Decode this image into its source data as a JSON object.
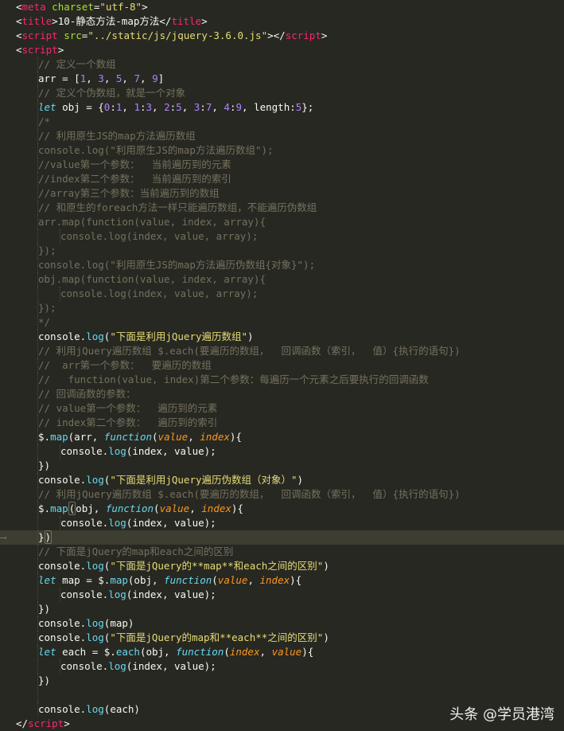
{
  "editor": {
    "lines": [
      {
        "indent": 0,
        "tokens": [
          {
            "t": "<",
            "c": "text"
          },
          {
            "t": "meta",
            "c": "tag"
          },
          {
            "t": " ",
            "c": "text"
          },
          {
            "t": "charset",
            "c": "attr"
          },
          {
            "t": "=",
            "c": "text"
          },
          {
            "t": "\"utf-8\"",
            "c": "str"
          },
          {
            "t": ">",
            "c": "text"
          }
        ]
      },
      {
        "indent": 0,
        "tokens": [
          {
            "t": "<",
            "c": "text"
          },
          {
            "t": "title",
            "c": "tag"
          },
          {
            "t": ">10-静态方法-map方法</",
            "c": "text"
          },
          {
            "t": "title",
            "c": "tag"
          },
          {
            "t": ">",
            "c": "text"
          }
        ]
      },
      {
        "indent": 0,
        "tokens": [
          {
            "t": "<",
            "c": "text"
          },
          {
            "t": "script",
            "c": "tag"
          },
          {
            "t": " ",
            "c": "text"
          },
          {
            "t": "src",
            "c": "attr"
          },
          {
            "t": "=",
            "c": "text"
          },
          {
            "t": "\"../static/js/jquery-3.6.0.js\"",
            "c": "str"
          },
          {
            "t": "></",
            "c": "text"
          },
          {
            "t": "script",
            "c": "tag"
          },
          {
            "t": ">",
            "c": "text"
          }
        ]
      },
      {
        "indent": 0,
        "tokens": [
          {
            "t": "<",
            "c": "text"
          },
          {
            "t": "script",
            "c": "tag"
          },
          {
            "t": ">",
            "c": "text"
          }
        ]
      },
      {
        "indent": 1,
        "tokens": [
          {
            "t": "// 定义一个数组",
            "c": "cmt"
          }
        ]
      },
      {
        "indent": 1,
        "tokens": [
          {
            "t": "arr = [",
            "c": "text"
          },
          {
            "t": "1",
            "c": "num"
          },
          {
            "t": ", ",
            "c": "text"
          },
          {
            "t": "3",
            "c": "num"
          },
          {
            "t": ", ",
            "c": "text"
          },
          {
            "t": "5",
            "c": "num"
          },
          {
            "t": ", ",
            "c": "text"
          },
          {
            "t": "7",
            "c": "num"
          },
          {
            "t": ", ",
            "c": "text"
          },
          {
            "t": "9",
            "c": "num"
          },
          {
            "t": "]",
            "c": "text"
          }
        ]
      },
      {
        "indent": 1,
        "tokens": [
          {
            "t": "// 定义个伪数组，就是一个对象",
            "c": "cmt"
          }
        ]
      },
      {
        "indent": 1,
        "tokens": [
          {
            "t": "let",
            "c": "kw"
          },
          {
            "t": " obj = {",
            "c": "text"
          },
          {
            "t": "0",
            "c": "num"
          },
          {
            "t": ":",
            "c": "text"
          },
          {
            "t": "1",
            "c": "num"
          },
          {
            "t": ", ",
            "c": "text"
          },
          {
            "t": "1",
            "c": "num"
          },
          {
            "t": ":",
            "c": "text"
          },
          {
            "t": "3",
            "c": "num"
          },
          {
            "t": ", ",
            "c": "text"
          },
          {
            "t": "2",
            "c": "num"
          },
          {
            "t": ":",
            "c": "text"
          },
          {
            "t": "5",
            "c": "num"
          },
          {
            "t": ", ",
            "c": "text"
          },
          {
            "t": "3",
            "c": "num"
          },
          {
            "t": ":",
            "c": "text"
          },
          {
            "t": "7",
            "c": "num"
          },
          {
            "t": ", ",
            "c": "text"
          },
          {
            "t": "4",
            "c": "num"
          },
          {
            "t": ":",
            "c": "text"
          },
          {
            "t": "9",
            "c": "num"
          },
          {
            "t": ", length:",
            "c": "text"
          },
          {
            "t": "5",
            "c": "num"
          },
          {
            "t": "};",
            "c": "text"
          }
        ]
      },
      {
        "indent": 1,
        "tokens": [
          {
            "t": "/*",
            "c": "cmt"
          }
        ]
      },
      {
        "indent": 1,
        "tokens": [
          {
            "t": "// 利用原生JS的map方法遍历数组",
            "c": "cmt"
          }
        ]
      },
      {
        "indent": 1,
        "tokens": [
          {
            "t": "console.log(\"利用原生JS的map方法遍历数组\");",
            "c": "cmt"
          }
        ]
      },
      {
        "indent": 1,
        "tokens": [
          {
            "t": "//value第一个参数：  当前遍历到的元素",
            "c": "cmt"
          }
        ]
      },
      {
        "indent": 1,
        "tokens": [
          {
            "t": "//index第二个参数：  当前遍历到的索引",
            "c": "cmt"
          }
        ]
      },
      {
        "indent": 1,
        "tokens": [
          {
            "t": "//array第三个参数：当前遍历到的数组",
            "c": "cmt"
          }
        ]
      },
      {
        "indent": 1,
        "tokens": [
          {
            "t": "// 和原生的foreach方法一样只能遍历数组，不能遍历伪数组",
            "c": "cmt"
          }
        ]
      },
      {
        "indent": 1,
        "tokens": [
          {
            "t": "arr.map(function(value, index, array){",
            "c": "cmt"
          }
        ]
      },
      {
        "indent": 2,
        "tokens": [
          {
            "t": "console.log(index, value, array);",
            "c": "cmt"
          }
        ]
      },
      {
        "indent": 1,
        "tokens": [
          {
            "t": "});",
            "c": "cmt"
          }
        ]
      },
      {
        "indent": 1,
        "tokens": [
          {
            "t": "console.log(\"利用原生JS的map方法遍历伪数组{对象}\");",
            "c": "cmt"
          }
        ]
      },
      {
        "indent": 1,
        "tokens": [
          {
            "t": "obj.map(function(value, index, array){",
            "c": "cmt"
          }
        ]
      },
      {
        "indent": 2,
        "tokens": [
          {
            "t": "console.log(index, value, array);",
            "c": "cmt"
          }
        ]
      },
      {
        "indent": 1,
        "tokens": [
          {
            "t": "});",
            "c": "cmt"
          }
        ]
      },
      {
        "indent": 1,
        "tokens": [
          {
            "t": "*/",
            "c": "cmt"
          }
        ]
      },
      {
        "indent": 1,
        "tokens": [
          {
            "t": "console.",
            "c": "text"
          },
          {
            "t": "log",
            "c": "fn"
          },
          {
            "t": "(",
            "c": "text"
          },
          {
            "t": "\"下面是利用jQuery遍历数组\"",
            "c": "str"
          },
          {
            "t": ")",
            "c": "text"
          }
        ]
      },
      {
        "indent": 1,
        "tokens": [
          {
            "t": "// 利用jQuery遍历数组 $.each(要遍历的数组，  回调函数（索引，  值）{执行的语句})",
            "c": "cmt"
          }
        ]
      },
      {
        "indent": 1,
        "tokens": [
          {
            "t": "//  arr第一个参数：  要遍历的数组",
            "c": "cmt"
          }
        ]
      },
      {
        "indent": 1,
        "tokens": [
          {
            "t": "//   function(value, index)第二个参数：每遍历一个元素之后要执行的回调函数",
            "c": "cmt"
          }
        ]
      },
      {
        "indent": 1,
        "tokens": [
          {
            "t": "// 回调函数的参数：",
            "c": "cmt"
          }
        ]
      },
      {
        "indent": 1,
        "tokens": [
          {
            "t": "// value第一个参数：  遍历到的元素",
            "c": "cmt"
          }
        ]
      },
      {
        "indent": 1,
        "tokens": [
          {
            "t": "// index第二个参数：  遍历到的索引",
            "c": "cmt"
          }
        ]
      },
      {
        "indent": 1,
        "tokens": [
          {
            "t": "$.",
            "c": "text"
          },
          {
            "t": "map",
            "c": "fn"
          },
          {
            "t": "(arr, ",
            "c": "text"
          },
          {
            "t": "function",
            "c": "kw"
          },
          {
            "t": "(",
            "c": "text"
          },
          {
            "t": "value",
            "c": "param"
          },
          {
            "t": ", ",
            "c": "text"
          },
          {
            "t": "index",
            "c": "param"
          },
          {
            "t": "){",
            "c": "text"
          }
        ]
      },
      {
        "indent": 2,
        "tokens": [
          {
            "t": "console.",
            "c": "text"
          },
          {
            "t": "log",
            "c": "fn"
          },
          {
            "t": "(index, value);",
            "c": "text"
          }
        ]
      },
      {
        "indent": 1,
        "tokens": [
          {
            "t": "})",
            "c": "text"
          }
        ]
      },
      {
        "indent": 1,
        "tokens": [
          {
            "t": "console.",
            "c": "text"
          },
          {
            "t": "log",
            "c": "fn"
          },
          {
            "t": "(",
            "c": "text"
          },
          {
            "t": "\"下面是利用jQuery遍历伪数组（对象）\"",
            "c": "str"
          },
          {
            "t": ")",
            "c": "text"
          }
        ]
      },
      {
        "indent": 1,
        "tokens": [
          {
            "t": "// 利用jQuery遍历数组 $.each(要遍历的数组，  回调函数（索引，  值）{执行的语句})",
            "c": "cmt"
          }
        ]
      },
      {
        "indent": 1,
        "tokens": [
          {
            "t": "$.",
            "c": "text"
          },
          {
            "t": "map",
            "c": "fn"
          },
          {
            "t": "(",
            "c": "cursor"
          },
          {
            "t": "obj, ",
            "c": "text"
          },
          {
            "t": "function",
            "c": "kw"
          },
          {
            "t": "(",
            "c": "text"
          },
          {
            "t": "value",
            "c": "param"
          },
          {
            "t": ", ",
            "c": "text"
          },
          {
            "t": "index",
            "c": "param"
          },
          {
            "t": "){",
            "c": "text"
          }
        ]
      },
      {
        "indent": 2,
        "tokens": [
          {
            "t": "console.",
            "c": "text"
          },
          {
            "t": "log",
            "c": "fn"
          },
          {
            "t": "(index, value);",
            "c": "text"
          }
        ]
      },
      {
        "indent": 1,
        "highlight": true,
        "tokens": [
          {
            "t": "}",
            "c": "text"
          },
          {
            "t": ")",
            "c": "cursor"
          }
        ]
      },
      {
        "indent": 1,
        "tokens": [
          {
            "t": "// 下面是jQuery的map和each之间的区别",
            "c": "cmt"
          }
        ]
      },
      {
        "indent": 1,
        "tokens": [
          {
            "t": "console.",
            "c": "text"
          },
          {
            "t": "log",
            "c": "fn"
          },
          {
            "t": "(",
            "c": "text"
          },
          {
            "t": "\"下面是jQuery的**map**和each之间的区别\"",
            "c": "str"
          },
          {
            "t": ")",
            "c": "text"
          }
        ]
      },
      {
        "indent": 1,
        "tokens": [
          {
            "t": "let",
            "c": "kw"
          },
          {
            "t": " map = $.",
            "c": "text"
          },
          {
            "t": "map",
            "c": "fn"
          },
          {
            "t": "(obj, ",
            "c": "text"
          },
          {
            "t": "function",
            "c": "kw"
          },
          {
            "t": "(",
            "c": "text"
          },
          {
            "t": "value",
            "c": "param"
          },
          {
            "t": ", ",
            "c": "text"
          },
          {
            "t": "index",
            "c": "param"
          },
          {
            "t": "){",
            "c": "text"
          }
        ]
      },
      {
        "indent": 2,
        "tokens": [
          {
            "t": "console.",
            "c": "text"
          },
          {
            "t": "log",
            "c": "fn"
          },
          {
            "t": "(index, value);",
            "c": "text"
          }
        ]
      },
      {
        "indent": 1,
        "tokens": [
          {
            "t": "})",
            "c": "text"
          }
        ]
      },
      {
        "indent": 1,
        "tokens": [
          {
            "t": "console.",
            "c": "text"
          },
          {
            "t": "log",
            "c": "fn"
          },
          {
            "t": "(map)",
            "c": "text"
          }
        ]
      },
      {
        "indent": 1,
        "tokens": [
          {
            "t": "console.",
            "c": "text"
          },
          {
            "t": "log",
            "c": "fn"
          },
          {
            "t": "(",
            "c": "text"
          },
          {
            "t": "\"下面是jQuery的map和**each**之间的区别\"",
            "c": "str"
          },
          {
            "t": ")",
            "c": "text"
          }
        ]
      },
      {
        "indent": 1,
        "tokens": [
          {
            "t": "let",
            "c": "kw"
          },
          {
            "t": " each = $.",
            "c": "text"
          },
          {
            "t": "each",
            "c": "fn"
          },
          {
            "t": "(obj, ",
            "c": "text"
          },
          {
            "t": "function",
            "c": "kw"
          },
          {
            "t": "(",
            "c": "text"
          },
          {
            "t": "index",
            "c": "param"
          },
          {
            "t": ", ",
            "c": "text"
          },
          {
            "t": "value",
            "c": "param"
          },
          {
            "t": "){",
            "c": "text"
          }
        ]
      },
      {
        "indent": 2,
        "tokens": [
          {
            "t": "console.",
            "c": "text"
          },
          {
            "t": "log",
            "c": "fn"
          },
          {
            "t": "(index, value);",
            "c": "text"
          }
        ]
      },
      {
        "indent": 1,
        "tokens": [
          {
            "t": "})",
            "c": "text"
          }
        ]
      },
      {
        "indent": 1,
        "tokens": []
      },
      {
        "indent": 1,
        "tokens": [
          {
            "t": "console.",
            "c": "text"
          },
          {
            "t": "log",
            "c": "fn"
          },
          {
            "t": "(each)",
            "c": "text"
          }
        ]
      },
      {
        "indent": 0,
        "tokens": [
          {
            "t": "</",
            "c": "text"
          },
          {
            "t": "script",
            "c": "tag"
          },
          {
            "t": ">",
            "c": "text"
          }
        ]
      }
    ]
  },
  "watermark": {
    "text": "头条 @学员港湾"
  },
  "colors": {
    "background": "#272822",
    "highlight": "#3E3D32",
    "tag": "#F92672",
    "attr": "#A6E22E",
    "string": "#E6DB74",
    "comment": "#75715E",
    "keyword": "#66D9EF",
    "number": "#AE81FF",
    "param": "#FD971F"
  }
}
